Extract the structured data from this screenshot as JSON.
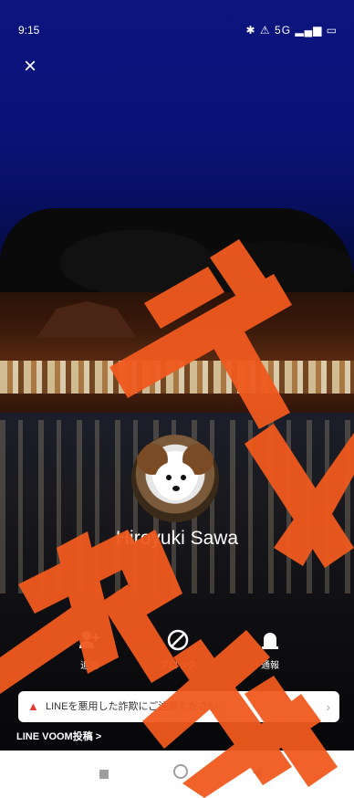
{
  "status_bar": {
    "time": "9:15",
    "right": "✱ ⚠ 5G ▂▄▆ ▭"
  },
  "header": {
    "close_label": "×"
  },
  "profile": {
    "name": "Hiroyuki Sawa"
  },
  "actions": [
    {
      "label": "追加",
      "icon": "add-friend-icon"
    },
    {
      "label": "ブロック",
      "icon": "block-icon"
    },
    {
      "label": "通報",
      "icon": "report-icon"
    }
  ],
  "alert": {
    "text": "LINEを悪用した詐欺にご注意ください。",
    "icon": "warning-icon"
  },
  "voom_link": "LINE VOOM投稿 >",
  "watermark": {
    "color": "#f05a1e"
  }
}
